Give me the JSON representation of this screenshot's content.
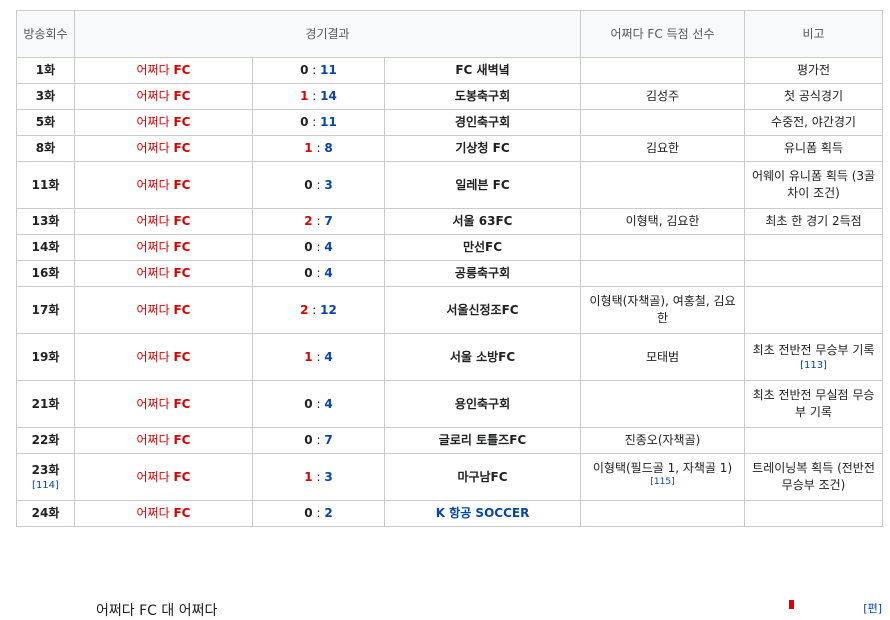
{
  "header": {
    "episode": "방송회수",
    "result": "경기결과",
    "scorers": "어쩌다 FC 득점 선수",
    "note": "비고"
  },
  "team": {
    "prefix": "어쩌다 ",
    "suffix": "FC"
  },
  "rows": [
    {
      "ep": "1화",
      "a": "0",
      "b": "11",
      "opp": "FC 새벽녘",
      "scorers": "",
      "note": "평가전",
      "tall": false
    },
    {
      "ep": "3화",
      "a": "1",
      "b": "14",
      "opp": "도봉축구회",
      "scorers": "김성주",
      "note": "첫 공식경기",
      "tall": false
    },
    {
      "ep": "5화",
      "a": "0",
      "b": "11",
      "opp": "경인축구회",
      "scorers": "",
      "note": "수중전, 야간경기",
      "tall": false
    },
    {
      "ep": "8화",
      "a": "1",
      "b": "8",
      "opp": "기상청 FC",
      "scorers": "김요한",
      "note": "유니폼 획득",
      "tall": false
    },
    {
      "ep": "11화",
      "a": "0",
      "b": "3",
      "opp": "일레븐 FC",
      "scorers": "",
      "note": "어웨이 유니폼 획득 (3골 차이 조건)",
      "tall": true
    },
    {
      "ep": "13화",
      "a": "2",
      "b": "7",
      "opp": "서울 63FC",
      "scorers": "이형택, 김요한",
      "note": "최초 한 경기 2득점",
      "tall": false
    },
    {
      "ep": "14화",
      "a": "0",
      "b": "4",
      "opp": "만선FC",
      "scorers": "",
      "note": "",
      "tall": false
    },
    {
      "ep": "16화",
      "a": "0",
      "b": "4",
      "opp": "공릉축구회",
      "scorers": "",
      "note": "",
      "tall": false
    },
    {
      "ep": "17화",
      "a": "2",
      "b": "12",
      "opp": "서울신정조FC",
      "scorers": "이형택(자책골), 여홍철, 김요한",
      "note": "",
      "tall": true
    },
    {
      "ep": "19화",
      "a": "1",
      "b": "4",
      "opp": "서울 소방FC",
      "scorers": "모태범",
      "note": "최초 전반전 무승부 기록",
      "note_ref": "[113]",
      "tall": true
    },
    {
      "ep": "21화",
      "a": "0",
      "b": "4",
      "opp": "용인축구회",
      "scorers": "",
      "note": "최초 전반전 무실점 무승부 기록",
      "tall": true
    },
    {
      "ep": "22화",
      "a": "0",
      "b": "7",
      "opp": "글로리 토틀즈FC",
      "scorers": "진종오(자책골)",
      "note": "",
      "tall": false
    },
    {
      "ep": "23화",
      "ep_ref": "[114]",
      "a": "1",
      "b": "3",
      "opp": "마구남FC",
      "scorers": "이형택(필드골 1, 자책골 1)",
      "scorers_ref": "[115]",
      "note": "트레이닝복 획득 (전반전 무승부 조건)",
      "tall": true
    },
    {
      "ep": "24화",
      "a": "0",
      "b": "2",
      "opp": "K 항공 SOCCER",
      "opp_link": true,
      "scorers": "",
      "note": "",
      "tall": false
    }
  ],
  "footer": {
    "fragment": "어쩌다 FC 대 어쩌다",
    "edit": "[편]"
  }
}
